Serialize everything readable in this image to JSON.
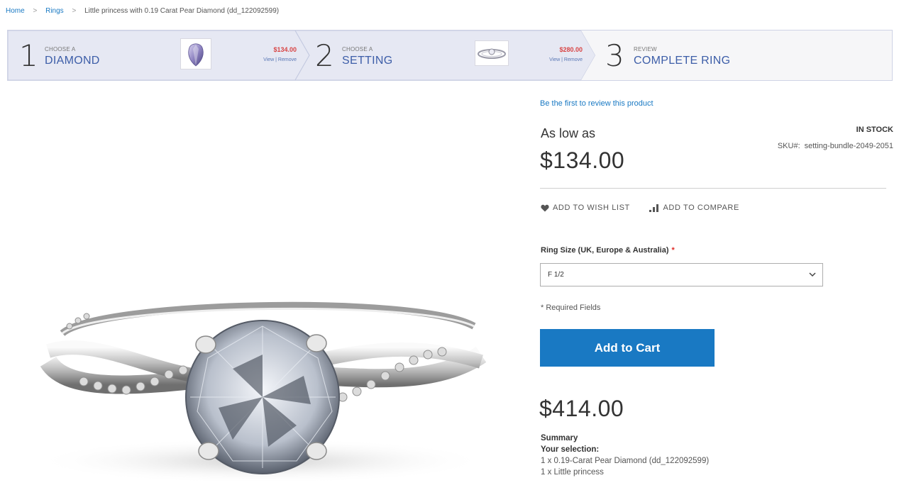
{
  "breadcrumb": {
    "home": "Home",
    "rings": "Rings",
    "current": "Little princess with 0.19 Carat Pear Diamond (dd_122092599)"
  },
  "steps": [
    {
      "number": "1",
      "small": "CHOOSE A",
      "big": "DIAMOND",
      "price": "$134.00",
      "view": "View",
      "remove": "Remove",
      "thumb": "pear-diamond"
    },
    {
      "number": "2",
      "small": "CHOOSE A",
      "big": "SETTING",
      "price": "$280.00",
      "view": "View",
      "remove": "Remove",
      "thumb": "ring-setting"
    },
    {
      "number": "3",
      "small": "REVIEW",
      "big": "COMPLETE RING"
    }
  ],
  "product": {
    "review_link": "Be the first to review this product",
    "as_low_as": "As low as",
    "price": "$134.00",
    "stock": "IN STOCK",
    "sku_label": "SKU#:",
    "sku": "setting-bundle-2049-2051",
    "wishlist": "ADD TO WISH LIST",
    "compare": "ADD TO COMPARE",
    "ring_size_label": "Ring Size (UK, Europe & Australia)",
    "required_star": "*",
    "ring_size_value": "F 1/2",
    "required_note": "* Required Fields",
    "add_to_cart": "Add to Cart",
    "total": "$414.00",
    "summary_title": "Summary",
    "selection_title": "Your selection:",
    "selection_items": [
      "1 x 0.19-Carat Pear Diamond (dd_122092599)",
      "1 x Little princess"
    ]
  },
  "colors": {
    "link": "#1979c3",
    "button": "#1979c3",
    "step_title": "#3d5ea8",
    "step_price": "#d84444",
    "required": "#e02b27"
  },
  "icons": [
    "chevron-right-icon",
    "heart-icon",
    "bar-chart-icon",
    "chevron-down-icon"
  ]
}
